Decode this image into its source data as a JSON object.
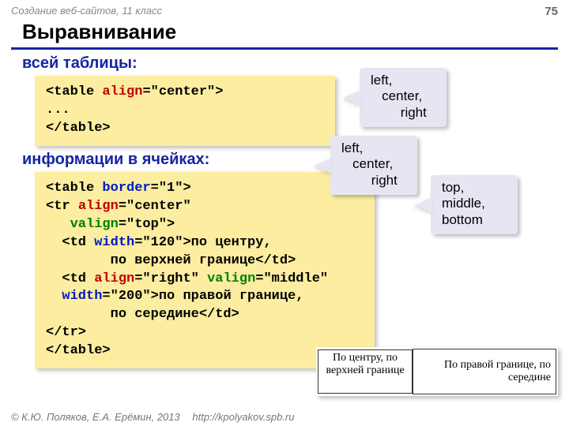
{
  "header": {
    "course": "Создание веб-сайтов, 11 класс",
    "page": "75"
  },
  "title": "Выравнивание",
  "section1": {
    "label": "всей таблицы:"
  },
  "code1": {
    "open_lt": "<",
    "tag_table": "table ",
    "attr_align": "align",
    "eq_center": "=\"center\">",
    "dots": "...",
    "close": "</table>"
  },
  "section2": {
    "label": "информации в ячейках:"
  },
  "code2": {
    "l1_a": "<table ",
    "l1_b": "border",
    "l1_c": "=\"1\">",
    "l2_a": "<tr ",
    "l2_b": "align",
    "l2_c": "=\"center\"",
    "l3_a": "   ",
    "l3_b": "valign",
    "l3_c": "=\"top\">",
    "l4_a": "  <td ",
    "l4_b": "width",
    "l4_c": "=\"120\">по центру,",
    "l5": "        по верхней границе</td>",
    "l6_a": "  <td ",
    "l6_b": "align",
    "l6_c": "=\"right\" ",
    "l6_d": "valign",
    "l6_e": "=\"middle\"",
    "l7_a": "  ",
    "l7_b": "width",
    "l7_c": "=\"200\">по правой границе,",
    "l8": "        по середине</td>",
    "l9": "</tr>",
    "l10": "</table>"
  },
  "callouts": {
    "align": {
      "l1": "left,",
      "l2": "   center,",
      "l3": "        right"
    },
    "align2": {
      "l1": "left,",
      "l2": "   center,",
      "l3": "        right"
    },
    "valign": {
      "l1": "top,",
      "l2": "middle,",
      "l3": "bottom"
    }
  },
  "example": {
    "cell1": "По центру, по верхней границе",
    "cell2": "По правой границе, по середине"
  },
  "footer": {
    "copy": "© К.Ю. Поляков, Е.А. Ерёмин, 2013",
    "url": "http://kpolyakov.spb.ru"
  }
}
